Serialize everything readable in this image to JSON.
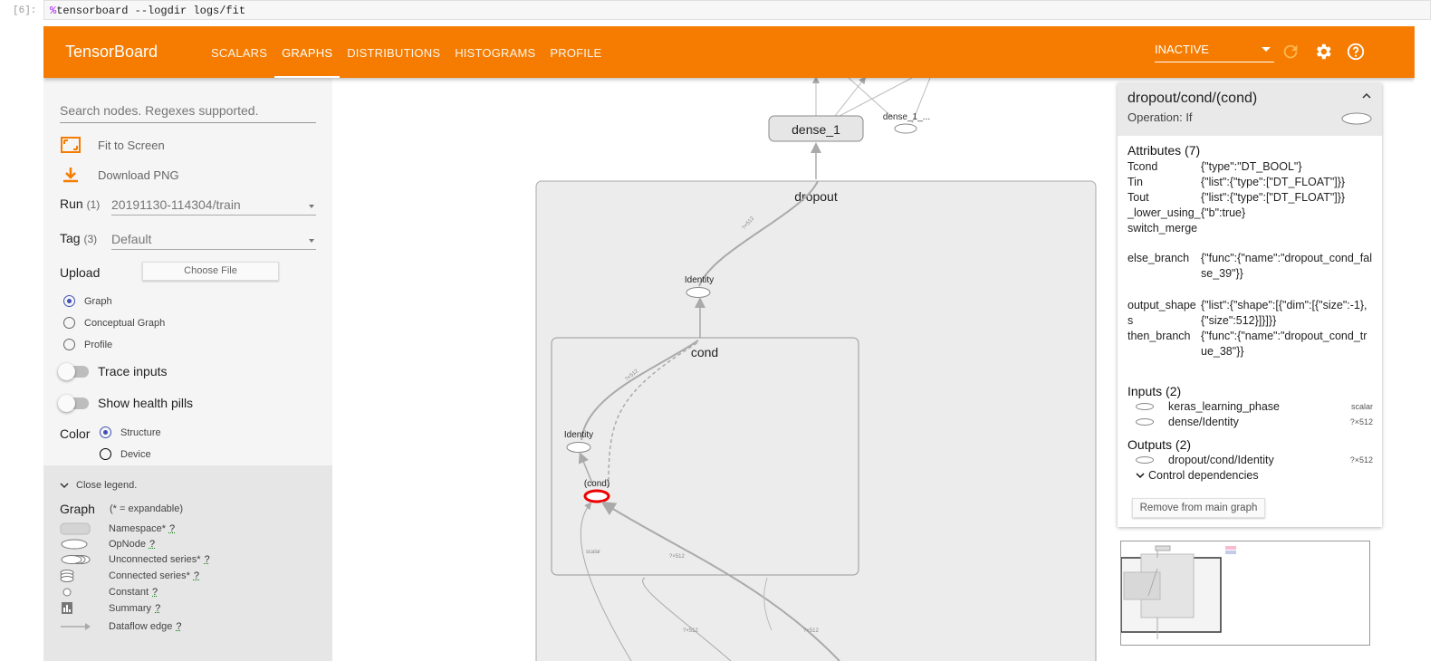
{
  "cell": {
    "prompt": "[6]:",
    "magic": "%",
    "command": "tensorboard --logdir logs/fit"
  },
  "app": {
    "brand": "TensorBoard",
    "tabs": [
      "SCALARS",
      "GRAPHS",
      "DISTRIBUTIONS",
      "HISTOGRAMS",
      "PROFILE"
    ],
    "active_tab": "GRAPHS",
    "status_select": "INACTIVE",
    "accent": "#f57c00"
  },
  "sidebar": {
    "search_placeholder": "Search nodes. Regexes supported.",
    "fit_label": "Fit to Screen",
    "download_label": "Download PNG",
    "run_label": "Run",
    "run_count": "(1)",
    "run_value": "20191130-114304/train",
    "tag_label": "Tag",
    "tag_count": "(3)",
    "tag_value": "Default",
    "upload_label": "Upload",
    "choose_file": "Choose File",
    "graph_types": [
      "Graph",
      "Conceptual Graph",
      "Profile"
    ],
    "trace_inputs": "Trace inputs",
    "health_pills": "Show health pills",
    "color_label": "Color",
    "color_options": [
      "Structure",
      "Device"
    ]
  },
  "legend": {
    "close": "Close legend.",
    "title": "Graph",
    "note": "(* = expandable)",
    "items": [
      "Namespace*",
      "OpNode",
      "Unconnected series*",
      "Connected series*",
      "Constant",
      "Summary",
      "Dataflow edge"
    ],
    "help": "?"
  },
  "graph": {
    "nodes": {
      "dense_1": "dense_1",
      "dense_1_small": "dense_1_...",
      "dropout": "dropout",
      "identity_outer": "Identity",
      "cond": "cond",
      "identity_inner": "Identity",
      "cond_op": "(cond)"
    },
    "edge_labels": [
      "?×512",
      "?×512",
      "?×512",
      "?×512",
      "?×512",
      "scalar"
    ]
  },
  "info": {
    "title": "dropout/cond/(cond)",
    "operation": "Operation: If",
    "attributes_header": "Attributes (7)",
    "attributes": [
      {
        "k": "Tcond",
        "v": "{\"type\":\"DT_BOOL\"}"
      },
      {
        "k": "Tin",
        "v": "{\"list\":{\"type\":[\"DT_FLOAT\"]}}"
      },
      {
        "k": "Tout",
        "v": "{\"list\":{\"type\":[\"DT_FLOAT\"]}}"
      },
      {
        "k": "_lower_using_switch_merge",
        "v": "{\"b\":true}"
      },
      {
        "k": "else_branch",
        "v": "{\"func\":{\"name\":\"dropout_cond_false_39\"}}"
      },
      {
        "k": "output_shapes",
        "v": "{\"list\":{\"shape\":[{\"dim\":[{\"size\":-1},{\"size\":512}]}]}}"
      },
      {
        "k": "then_branch",
        "v": "{\"func\":{\"name\":\"dropout_cond_true_38\"}}"
      }
    ],
    "inputs_header": "Inputs (2)",
    "inputs": [
      {
        "name": "keras_learning_phase",
        "shape": "scalar"
      },
      {
        "name": "dense/Identity",
        "shape": "?×512"
      }
    ],
    "outputs_header": "Outputs (2)",
    "outputs": [
      {
        "name": "dropout/cond/Identity",
        "shape": "?×512"
      }
    ],
    "control_deps": "Control dependencies",
    "remove_button": "Remove from main graph"
  }
}
